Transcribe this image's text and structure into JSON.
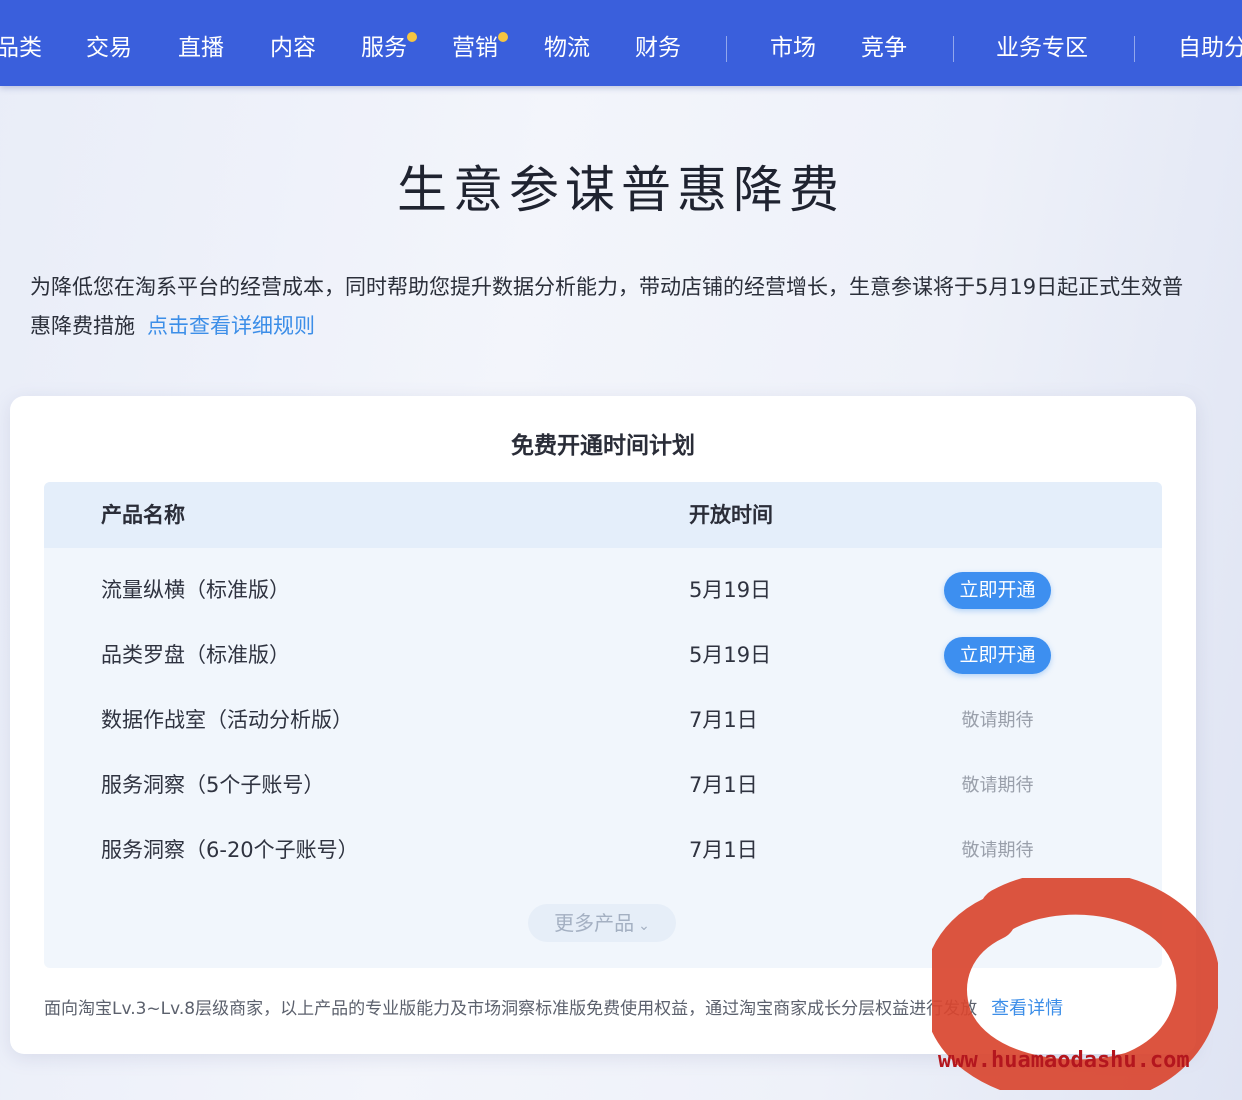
{
  "nav": {
    "items": [
      {
        "label": "品类",
        "dot": false
      },
      {
        "label": "交易",
        "dot": false
      },
      {
        "label": "直播",
        "dot": false
      },
      {
        "label": "内容",
        "dot": false
      },
      {
        "label": "服务",
        "dot": true
      },
      {
        "label": "营销",
        "dot": true
      },
      {
        "label": "物流",
        "dot": false
      },
      {
        "label": "财务",
        "dot": false
      },
      {
        "label": "市场",
        "dot": false
      },
      {
        "label": "竞争",
        "dot": false
      },
      {
        "label": "业务专区",
        "dot": false
      },
      {
        "label": "自助分",
        "dot": false
      }
    ],
    "dot_color": "#f5c542",
    "bg_color": "#3a5fdc"
  },
  "page": {
    "title": "生意参谋普惠降费",
    "intro": "为降低您在淘系平台的经营成本，同时帮助您提升数据分析能力，带动店铺的经营增长，生意参谋将于5月19日起正式生效普惠降费措施",
    "intro_link": "点击查看详细规则"
  },
  "card": {
    "title": "免费开通时间计划",
    "columns": [
      "产品名称",
      "开放时间"
    ],
    "rows": [
      {
        "name": "流量纵横（标准版）",
        "time": "5月19日",
        "action": "立即开通",
        "type": "button"
      },
      {
        "name": "品类罗盘（标准版）",
        "time": "5月19日",
        "action": "立即开通",
        "type": "button"
      },
      {
        "name": "数据作战室（活动分析版）",
        "time": "7月1日",
        "action": "敬请期待",
        "type": "text"
      },
      {
        "name": "服务洞察（5个子账号）",
        "time": "7月1日",
        "action": "敬请期待",
        "type": "text"
      },
      {
        "name": "服务洞察（6-20个子账号）",
        "time": "7月1日",
        "action": "敬请期待",
        "type": "text"
      }
    ],
    "more_label": "更多产品",
    "footnote": "面向淘宝Lv.3~Lv.8层级商家，以上产品的专业版能力及市场洞察标准版免费使用权益，通过淘宝商家成长分层权益进行发放",
    "footnote_link": "查看详情"
  },
  "overlay": {
    "watermark": "www.huamaodashu.com",
    "mark_color": "#d9452f"
  }
}
